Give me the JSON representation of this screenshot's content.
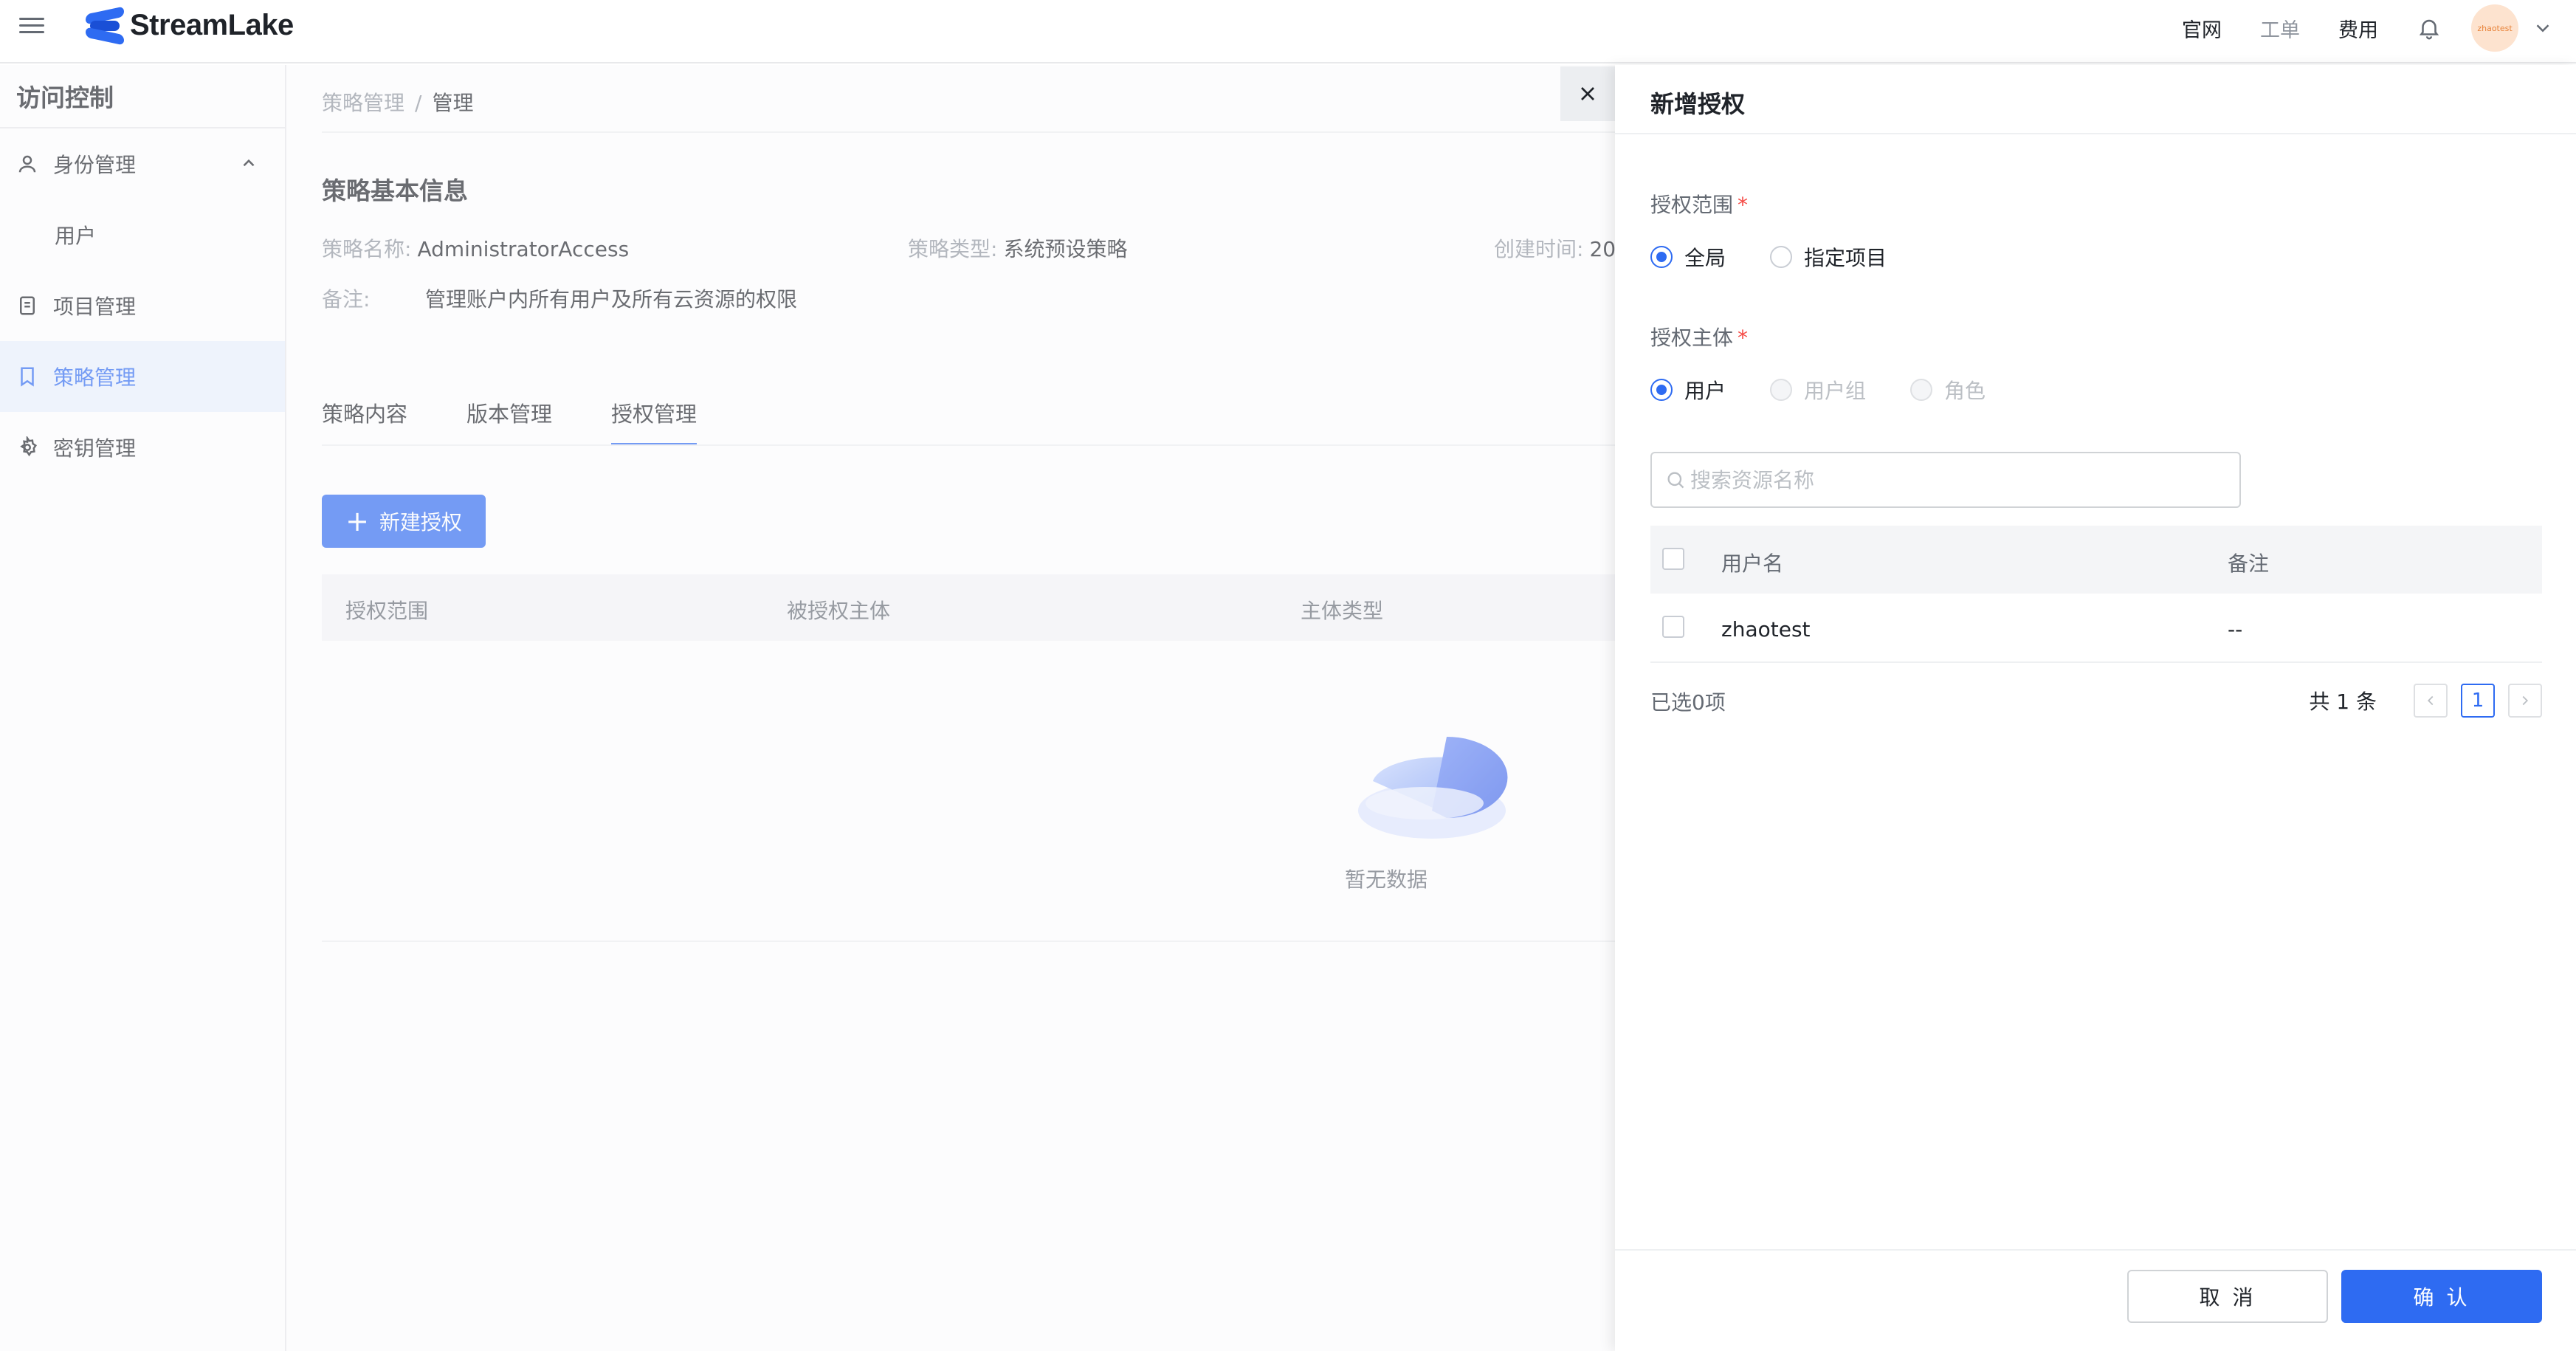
{
  "topbar": {
    "brand": "StreamLake",
    "links": [
      "官网",
      "工单",
      "费用"
    ],
    "avatar_text": "zhaotest"
  },
  "sidebar": {
    "title": "访问控制",
    "items": [
      {
        "label": "身份管理",
        "icon": "user-icon"
      },
      {
        "label": "用户",
        "icon": ""
      },
      {
        "label": "项目管理",
        "icon": "file-icon"
      },
      {
        "label": "策略管理",
        "icon": "bookmark-icon"
      },
      {
        "label": "密钥管理",
        "icon": "settings-icon"
      }
    ]
  },
  "main": {
    "breadcrumb": {
      "parent": "策略管理",
      "sep": "/",
      "current": "管理"
    },
    "section_title": "策略基本信息",
    "fields": {
      "name_label": "策略名称:",
      "name_value": "AdministratorAccess",
      "type_label": "策略类型:",
      "type_value": "系统预设策略",
      "created_label": "创建时间:",
      "created_value": "20",
      "remark_label": "备注:",
      "remark_value": "管理账户内所有用户及所有云资源的权限"
    },
    "tabs": [
      "策略内容",
      "版本管理",
      "授权管理"
    ],
    "new_button": "新建授权",
    "table_headers": [
      "授权范围",
      "被授权主体",
      "主体类型"
    ],
    "empty_text": "暂无数据"
  },
  "drawer": {
    "title": "新增授权",
    "scope_label": "授权范围",
    "scope_options": [
      "全局",
      "指定项目"
    ],
    "subject_label": "授权主体",
    "subject_options": [
      "用户",
      "用户组",
      "角色"
    ],
    "search_placeholder": "搜索资源名称",
    "table_headers": [
      "用户名",
      "备注"
    ],
    "rows": [
      {
        "username": "zhaotest",
        "remark": "--"
      }
    ],
    "selected_text": "已选0项",
    "total_text": "共 1 条",
    "page_current": "1",
    "cancel": "取 消",
    "confirm": "确 认"
  },
  "colors": {
    "primary": "#2e6bf2",
    "active_bg": "#eaf1fe",
    "required": "#f54a45"
  }
}
